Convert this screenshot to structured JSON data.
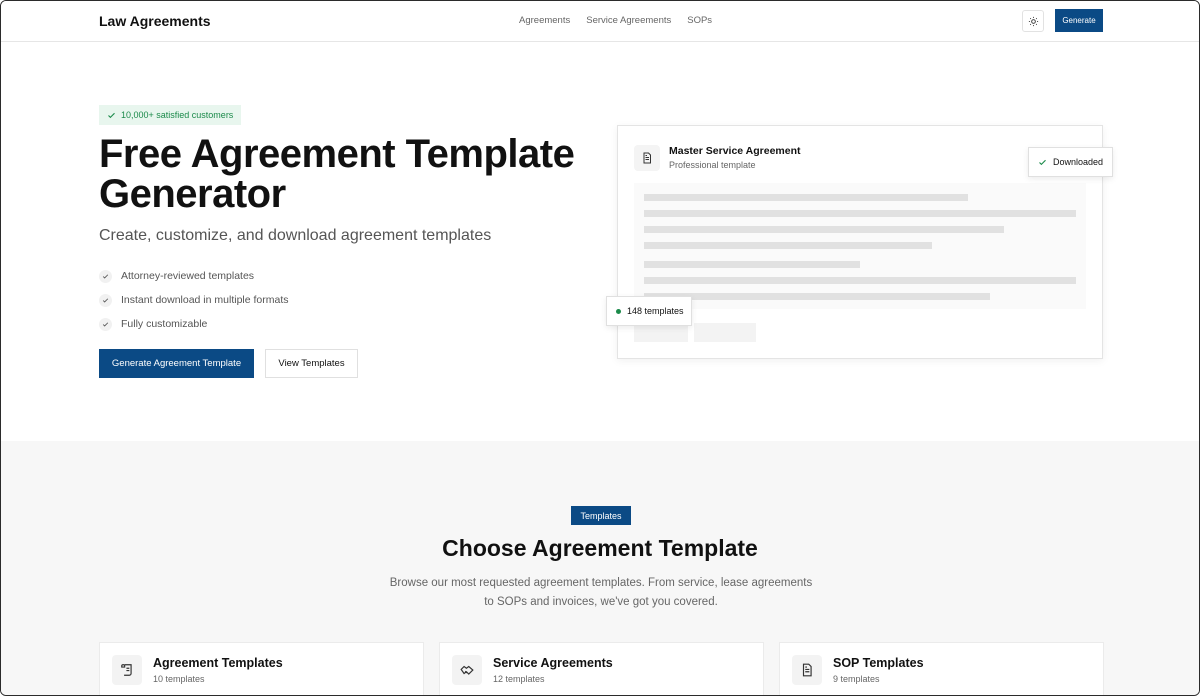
{
  "header": {
    "brand": "Law Agreements",
    "nav": [
      "Agreements",
      "Service Agreements",
      "SOPs"
    ],
    "generate_label": "Generate"
  },
  "hero": {
    "badge": "10,000+ satisfied customers",
    "title": "Free Agreement Template Generator",
    "subtitle": "Create, customize, and download agreement templates",
    "features": [
      "Attorney-reviewed templates",
      "Instant download in multiple formats",
      "Fully customizable"
    ],
    "primary_cta": "Generate Agreement Template",
    "secondary_cta": "View Templates"
  },
  "preview": {
    "title": "Master Service Agreement",
    "subtitle": "Professional template",
    "downloaded_label": "Downloaded",
    "count_label": "148 templates"
  },
  "section": {
    "tag": "Templates",
    "title": "Choose Agreement Template",
    "description_line1": "Browse our most requested agreement templates. From service, lease agreements",
    "description_line2": "to SOPs and invoices, we've got you covered.",
    "cards": [
      {
        "title": "Agreement Templates",
        "count": "10 templates",
        "icon": "scroll-icon"
      },
      {
        "title": "Service Agreements",
        "count": "12 templates",
        "icon": "handshake-icon"
      },
      {
        "title": "SOP Templates",
        "count": "9 templates",
        "icon": "document-icon"
      }
    ]
  },
  "colors": {
    "primary": "#0b4a85",
    "success": "#1b8a4a",
    "badge_bg": "#e8f6ee"
  }
}
